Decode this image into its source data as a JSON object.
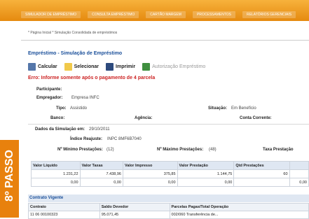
{
  "header": {
    "menu": [
      "SIMULADOR DE EMPRÉSTIMO",
      "CONSULTA EMPRÉSTIMO",
      "CARTÃO MARGEM",
      "PROCESSAMENTOS",
      "RELATÓRIOS GERENCIAIS"
    ]
  },
  "breadcrumb": "* Página Inicial  * Simulação Consolidada de empréstimos",
  "section_title": "Empréstimo - Simulação de Empréstimo",
  "toolbar": {
    "calcular": "Calcular",
    "selecionar": "Selecionar",
    "imprimir": "Imprimir",
    "autorizacao": "Autorização Empréstimo"
  },
  "error_message": "Erro: Informe somente após o pagamento de 4 parcela",
  "fields": {
    "participante_label": "Participante:",
    "empregador_label": "Empregador:",
    "empregador_value": "Empresa INFC",
    "tipo_label": "Tipo:",
    "tipo_value": "Assistido",
    "situacao_label": "Situação:",
    "situacao_value": "Em Benefício",
    "banco_label": "Banco:",
    "agencia_label": "Agência:",
    "conta_label": "Conta Corrente:"
  },
  "simulacao": {
    "data_label": "Dados da Simulação em:",
    "data_value": "29/10/2011",
    "indice_label": "Índice Reajuste:",
    "indice_value": "INPC 8MF6B7040",
    "min_label": "Nº Mínimo Prestações:",
    "min_value": "(12)",
    "max_label": "Nº Máximo Prestações:",
    "max_value": "(48)",
    "taxa_label": "Taxa Prestação"
  },
  "step": "8º PASSO",
  "table1": {
    "headers": [
      "Valor Líquido",
      "Valor Taxas",
      "Valor Impresso",
      "Valor Prestação",
      "Qtd Prestações",
      ""
    ],
    "rows": [
      [
        "1.231,22",
        "7.438,96",
        "375,85",
        "1.144,75",
        "60",
        ""
      ],
      [
        "0,00",
        "0,00",
        "0,00",
        "0,00",
        "",
        "0,00"
      ]
    ]
  },
  "contratos": {
    "title": "Contrato Vigente",
    "headers": [
      "Contrato",
      "Saldo Devedor",
      "Parcelas Pagas/Total Operação"
    ],
    "rows": [
      [
        "11 06 00100323",
        "95.071,45",
        "002/060 Transferência de..."
      ]
    ]
  }
}
